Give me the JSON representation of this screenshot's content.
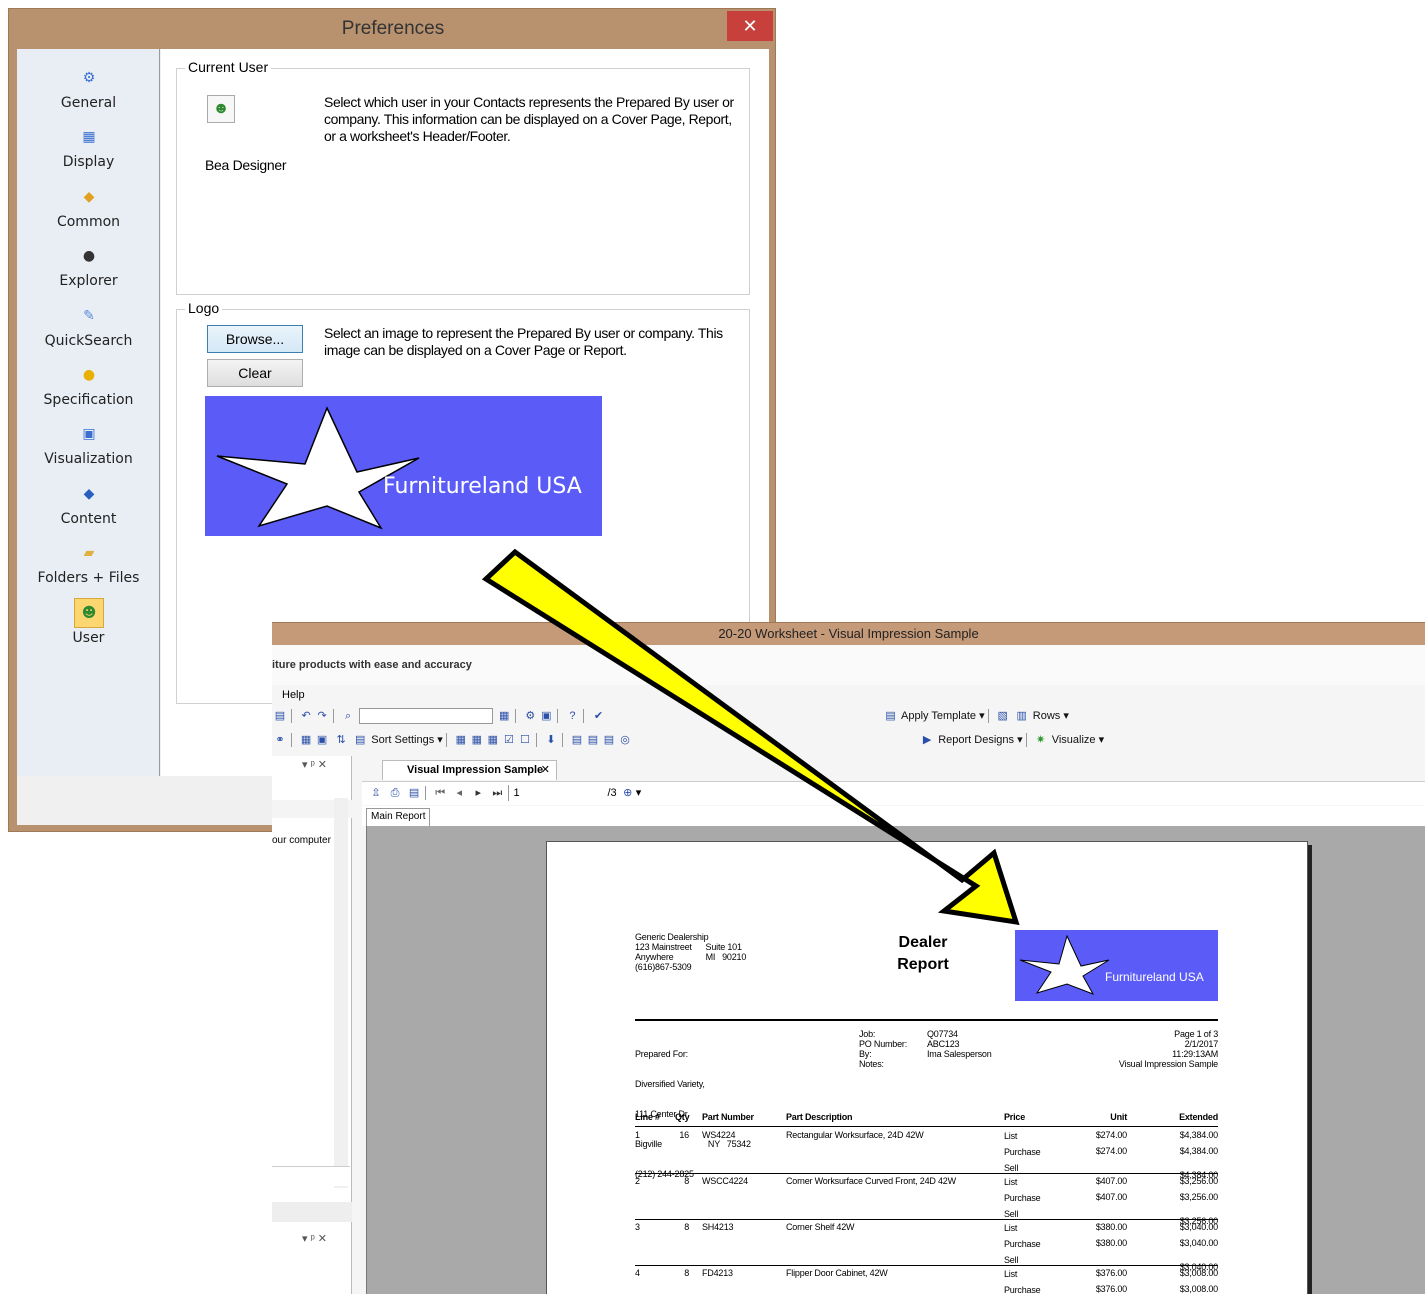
{
  "preferences": {
    "title": "Preferences",
    "close_glyph": "✕",
    "sidebar": [
      {
        "label": "General",
        "icon": "general-icon",
        "glyph": "⚙",
        "color": "#3a6fd0"
      },
      {
        "label": "Display",
        "icon": "display-icon",
        "glyph": "▦",
        "color": "#3a6fd0"
      },
      {
        "label": "Common",
        "icon": "common-icon",
        "glyph": "◆",
        "color": "#e0a020"
      },
      {
        "label": "Explorer",
        "icon": "explorer-icon",
        "glyph": "●",
        "color": "#333333"
      },
      {
        "label": "QuickSearch",
        "icon": "quicksearch-icon",
        "glyph": "✎",
        "color": "#5a8ad8"
      },
      {
        "label": "Specification",
        "icon": "specification-icon",
        "glyph": "●",
        "color": "#e8b000"
      },
      {
        "label": "Visualization",
        "icon": "visualization-icon",
        "glyph": "▣",
        "color": "#3a6fd0"
      },
      {
        "label": "Content",
        "icon": "content-icon",
        "glyph": "◆",
        "color": "#2860c0"
      },
      {
        "label": "Folders + Files",
        "icon": "folder-icon",
        "glyph": "▰",
        "color": "#e0b040"
      },
      {
        "label": "User",
        "icon": "user-icon",
        "glyph": "☻",
        "color": "#2f8a2f"
      }
    ],
    "current_user": {
      "group_label": "Current User",
      "description": "Select which user in your Contacts represents the Prepared By user or company.  This information can be displayed on a Cover Page, Report, or a worksheet's Header/Footer.",
      "user_name": "Bea Designer"
    },
    "logo": {
      "group_label": "Logo",
      "browse_label": "Browse...",
      "clear_label": "Clear",
      "description": "Select an image to represent the Prepared By user or company.  This image can be displayed on a Cover Page or Report.",
      "logo_text": "Furnitureland USA",
      "logo_bg": "#5b5cf7"
    }
  },
  "worksheet": {
    "title": "20-20 Worksheet - Visual Impression Sample",
    "tagline": "iture products with ease and accuracy",
    "menu_help": "Help",
    "toolbar1": {
      "apply_template": "Apply Template",
      "rows": "Rows"
    },
    "toolbar2": {
      "sort_settings": "Sort Settings",
      "report_designs": "Report Designs",
      "visualize": "Visualize"
    },
    "doc_tab": "Visual Impression Sample",
    "report_toolbar": {
      "page_value": "1",
      "page_total": "/3"
    },
    "main_report_tab": "Main Report",
    "left_panel_text": "our computer",
    "report": {
      "dealer": [
        "Generic Dealership",
        "123 Mainstreet      Suite 101",
        "Anywhere              MI   90210",
        "(616)867-5309"
      ],
      "heading": [
        "Dealer",
        "Report"
      ],
      "logo_text": "Furnitureland USA",
      "prepared_for": [
        "Prepared For:",
        "Diversified Variety,",
        "111 Center Dr.",
        "Bigville                    NY   75342",
        "(212) 244-2825"
      ],
      "job_labels": [
        "Job:",
        "PO Number:",
        "By:",
        "Notes:"
      ],
      "job_values": [
        "Q07734",
        "ABC123",
        "Ima Salesperson",
        ""
      ],
      "page_info": [
        "Page 1 of 3",
        "2/1/2017",
        "11:29:13AM",
        "Visual Impression Sample"
      ],
      "columns": [
        "Line #",
        "Qty",
        "Part Number",
        "Part Description",
        "Price",
        "Unit",
        "Extended"
      ],
      "rows": [
        {
          "line": "1",
          "qty": "16",
          "part": "WS4224",
          "desc": "Rectangular Worksurface, 24D 42W",
          "prices": [
            "List",
            "Purchase",
            "Sell"
          ],
          "units": [
            "$274.00",
            "$274.00",
            ""
          ],
          "ext": [
            "$4,384.00",
            "$4,384.00",
            "$4,384.00"
          ]
        },
        {
          "line": "2",
          "qty": "8",
          "part": "WSCC4224",
          "desc": "Corner Worksurface Curved Front, 24D 42W",
          "prices": [
            "List",
            "Purchase",
            "Sell"
          ],
          "units": [
            "$407.00",
            "$407.00",
            ""
          ],
          "ext": [
            "$3,256.00",
            "$3,256.00",
            "$3,256.00"
          ]
        },
        {
          "line": "3",
          "qty": "8",
          "part": "SH4213",
          "desc": "Corner Shelf 42W",
          "prices": [
            "List",
            "Purchase",
            "Sell"
          ],
          "units": [
            "$380.00",
            "$380.00",
            ""
          ],
          "ext": [
            "$3,040.00",
            "$3,040.00",
            "$3,040.00"
          ]
        },
        {
          "line": "4",
          "qty": "8",
          "part": "FD4213",
          "desc": "Flipper Door Cabinet, 42W",
          "prices": [
            "List",
            "Purchase"
          ],
          "units": [
            "$376.00",
            "$376.00"
          ],
          "ext": [
            "$3,008.00",
            "$3,008.00"
          ]
        }
      ]
    }
  },
  "colors": {
    "arrow_fill": "#ffff00",
    "arrow_stroke": "#000000",
    "logo_blue": "#5b5cf7"
  }
}
